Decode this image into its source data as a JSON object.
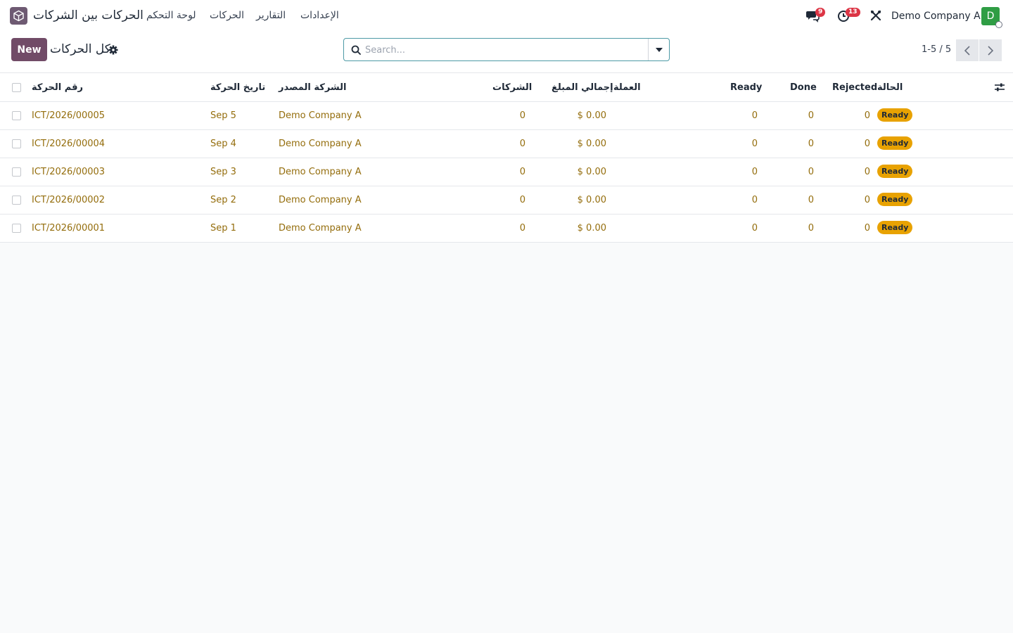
{
  "navbar": {
    "app_name": "الحركات بين الشركات",
    "menu": [
      {
        "label": "لوحة التحكم"
      },
      {
        "label": "الحركات"
      },
      {
        "label": "التقارير"
      },
      {
        "label": "الإعدادات"
      }
    ],
    "messages_count": "9",
    "activities_count": "13",
    "company": "Demo Company A",
    "avatar_letter": "D"
  },
  "control_panel": {
    "new_label": "New",
    "breadcrumb": "كل الحركات",
    "search_placeholder": "Search...",
    "pager": "1-5 / 5"
  },
  "table": {
    "columns": {
      "ref": "رقم الحركة",
      "date": "تاريخ الحركة",
      "source_company": "الشركة المصدر",
      "companies": "الشركات",
      "total": "إجمالي المبلغ",
      "currency": "العملة",
      "ready": "Ready",
      "done": "Done",
      "rejected": "Rejected",
      "state": "الحالة"
    },
    "rows": [
      {
        "ref": "ICT/2026/00005",
        "date": "Sep 5",
        "source_company": "Demo Company A",
        "companies": "0",
        "total": "$ 0.00",
        "ready": "0",
        "done": "0",
        "rejected": "0",
        "state": "Ready"
      },
      {
        "ref": "ICT/2026/00004",
        "date": "Sep 4",
        "source_company": "Demo Company A",
        "companies": "0",
        "total": "$ 0.00",
        "ready": "0",
        "done": "0",
        "rejected": "0",
        "state": "Ready"
      },
      {
        "ref": "ICT/2026/00003",
        "date": "Sep 3",
        "source_company": "Demo Company A",
        "companies": "0",
        "total": "$ 0.00",
        "ready": "0",
        "done": "0",
        "rejected": "0",
        "state": "Ready"
      },
      {
        "ref": "ICT/2026/00002",
        "date": "Sep 2",
        "source_company": "Demo Company A",
        "companies": "0",
        "total": "$ 0.00",
        "ready": "0",
        "done": "0",
        "rejected": "0",
        "state": "Ready"
      },
      {
        "ref": "ICT/2026/00001",
        "date": "Sep 1",
        "source_company": "Demo Company A",
        "companies": "0",
        "total": "$ 0.00",
        "ready": "0",
        "done": "0",
        "rejected": "0",
        "state": "Ready"
      }
    ]
  },
  "colors": {
    "brand": "#714b67",
    "link": "#946d0c",
    "status_ready": "#e8a202",
    "badge": "#dc3545",
    "avatar": "#2f9d44"
  }
}
